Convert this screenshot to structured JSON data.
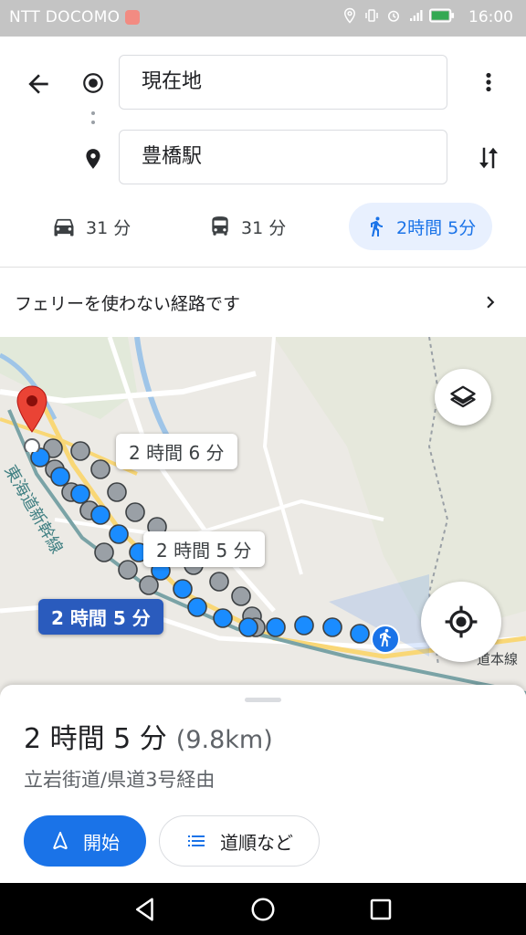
{
  "status_bar": {
    "carrier": "NTT DOCOMO",
    "time": "16:00"
  },
  "search": {
    "origin": "現在地",
    "destination": "豊橋駅"
  },
  "modes": [
    {
      "icon": "car-icon",
      "label": "31 分"
    },
    {
      "icon": "bus-icon",
      "label": "31 分"
    },
    {
      "icon": "walk-icon",
      "label": "2時間 5分",
      "active": true
    }
  ],
  "notice": {
    "text": "フェリーを使わない経路です"
  },
  "map": {
    "callouts": [
      {
        "text": "2 時間 6 分"
      },
      {
        "text": "2 時間 5 分"
      },
      {
        "text": "2 時間 5 分",
        "selected": true
      }
    ],
    "rail_label": "東海道新幹線",
    "road_label": "道本線"
  },
  "route_summary": {
    "duration": "2 時間 5 分",
    "distance": "(9.8km)",
    "via": "立岩街道/県道3号経由"
  },
  "actions": {
    "start": "開始",
    "steps": "道順など"
  },
  "colors": {
    "accent": "#1a73e8",
    "route_selected": "#1a8cff",
    "route_alt": "#9aa0a6"
  }
}
